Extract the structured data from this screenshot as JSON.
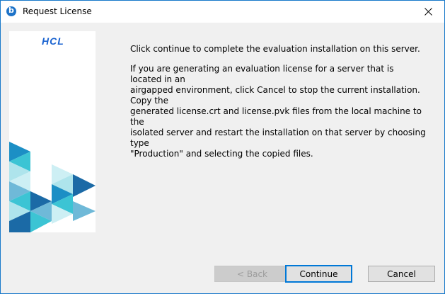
{
  "window": {
    "title": "Request License",
    "app_icon": "b-logo-icon",
    "close_icon": "close-icon"
  },
  "banner": {
    "logo_text": "HCL",
    "brand_color": "#1a63d0",
    "triangle_colors": [
      "#1c8fc5",
      "#3cc4d4",
      "#aee4ec",
      "#1b6aa6",
      "#6fb9d8",
      "#cdeff4"
    ]
  },
  "content": {
    "line1": "Click continue to complete the evaluation installation on this server.",
    "para2_lines": [
      "If you are generating an evaluation license for a server that is located in an",
      "airgapped environment, click Cancel to stop the current installation. Copy the",
      "generated license.crt and license.pvk files from the local machine to the",
      "isolated server and restart the installation on that server by choosing type",
      "\"Production\" and selecting the copied files."
    ]
  },
  "buttons": {
    "back": "< Back",
    "continue": "Continue",
    "cancel": "Cancel"
  }
}
